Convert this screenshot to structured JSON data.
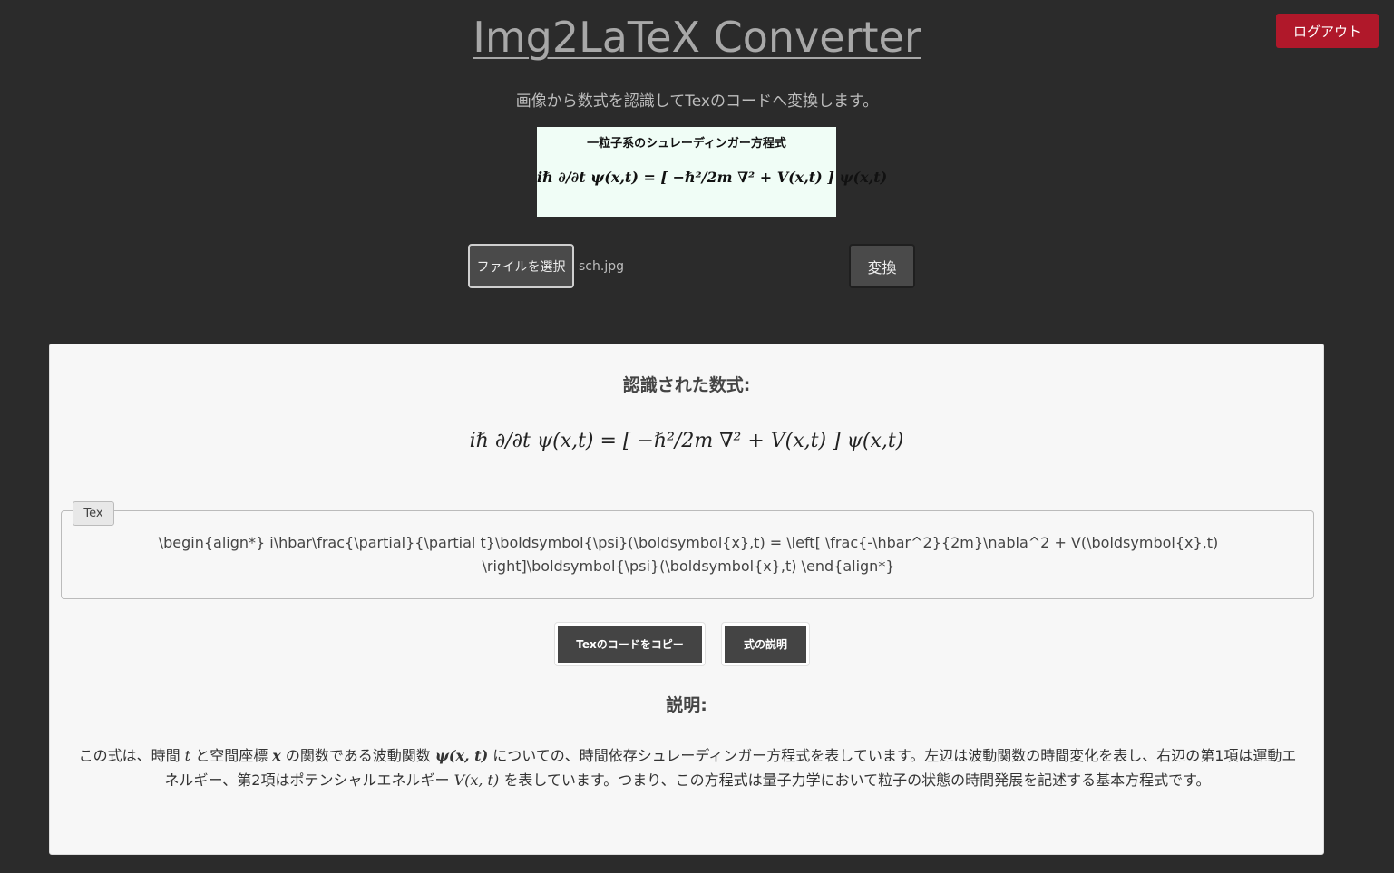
{
  "header": {
    "title": "Img2LaTeX Converter",
    "subtitle": "画像から数式を認識してTexのコードへ変換します。",
    "logout_label": "ログアウト"
  },
  "preview_image": {
    "caption": "一粒子系のシュレーディンガー方程式",
    "equation": "iℏ ∂/∂t ψ(x,t) = [ −ℏ²/2m ∇² + V(x,t) ] ψ(x,t)"
  },
  "upload": {
    "choose_file_label": "ファイルを選択",
    "file_name": "sch.jpg",
    "convert_label": "変換"
  },
  "result": {
    "heading": "認識された数式:",
    "rendered_equation": "iℏ ∂/∂t ψ(x,t) = [ −ℏ²/2m ∇² + V(x,t) ] ψ(x,t)",
    "tex_tag": "Tex",
    "tex_code": "\\begin{align*} i\\hbar\\frac{\\partial}{\\partial t}\\boldsymbol{\\psi}(\\boldsymbol{x},t) = \\left[ \\frac{-\\hbar^2}{2m}\\nabla^2 + V(\\boldsymbol{x},t) \\right]\\boldsymbol{\\psi}(\\boldsymbol{x},t) \\end{align*}",
    "copy_label": "Texのコードをコピー",
    "explain_label": "式の説明"
  },
  "explanation": {
    "heading": "説明:",
    "p1": "この式は、時間 ",
    "m1": "t",
    "p2": " と空間座標 ",
    "m2": "x",
    "p3": " の関数である波動関数 ",
    "m3": "ψ(x, t)",
    "p4": " についての、時間依存シュレーディンガー方程式を表しています。左辺は波動関数の時間変化を表し、右辺の第1項は運動エネルギー、第2項はポテンシャルエネルギー ",
    "m4": "V(x, t)",
    "p5": " を表しています。つまり、この方程式は量子力学において粒子の状態の時間発展を記述する基本方程式です。"
  },
  "colors": {
    "background": "#2b2b2b",
    "logout": "#b0182a",
    "panel": "#f7f7f7",
    "button": "#444444"
  }
}
